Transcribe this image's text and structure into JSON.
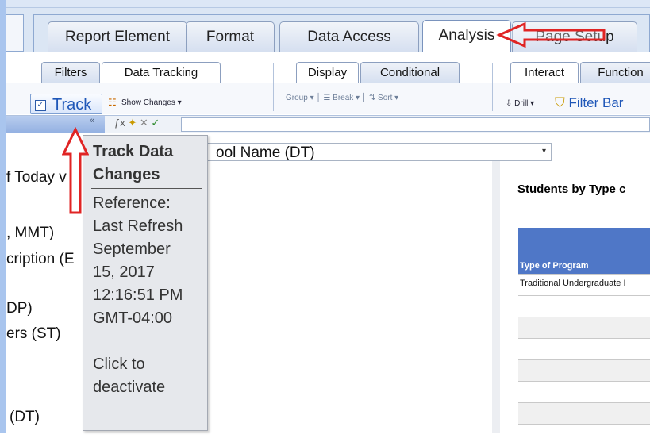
{
  "tabs": [
    {
      "label": "Report Element"
    },
    {
      "label": "Format"
    },
    {
      "label": "Data Access"
    },
    {
      "label": "Analysis",
      "active": true
    },
    {
      "label": "Page Setup"
    }
  ],
  "subtabs": {
    "group1": [
      "Filters",
      "Data Tracking"
    ],
    "group2": [
      "Display",
      "Conditional"
    ],
    "group3": [
      "Interact",
      "Function"
    ]
  },
  "toolbar": {
    "track_label": "Track",
    "show_changes_label": "Show Changes",
    "group_label": "Group",
    "break_label": "Break",
    "sort_label": "Sort",
    "drill_label": "Drill",
    "filter_bar_label": "Filter Bar"
  },
  "dropdown": {
    "value": "ool Name (DT)"
  },
  "left_panel": [
    "f Today v",
    ", MMT)",
    "cription (E",
    "DP)",
    "ers (ST)",
    "(DT)"
  ],
  "tooltip": {
    "title_line1": "Track Data",
    "title_line2": "Changes",
    "lines": [
      "Reference:",
      "Last Refresh",
      "September",
      "15, 2017",
      "12:16:51 PM",
      "GMT-04:00",
      "",
      "Click to",
      "deactivate"
    ]
  },
  "report": {
    "title": "Students by Type c",
    "header": "Type of Program",
    "first_row": "Traditional Undergraduate I"
  },
  "colors": {
    "accent": "#4f77c7",
    "annotation": "#e02424"
  }
}
